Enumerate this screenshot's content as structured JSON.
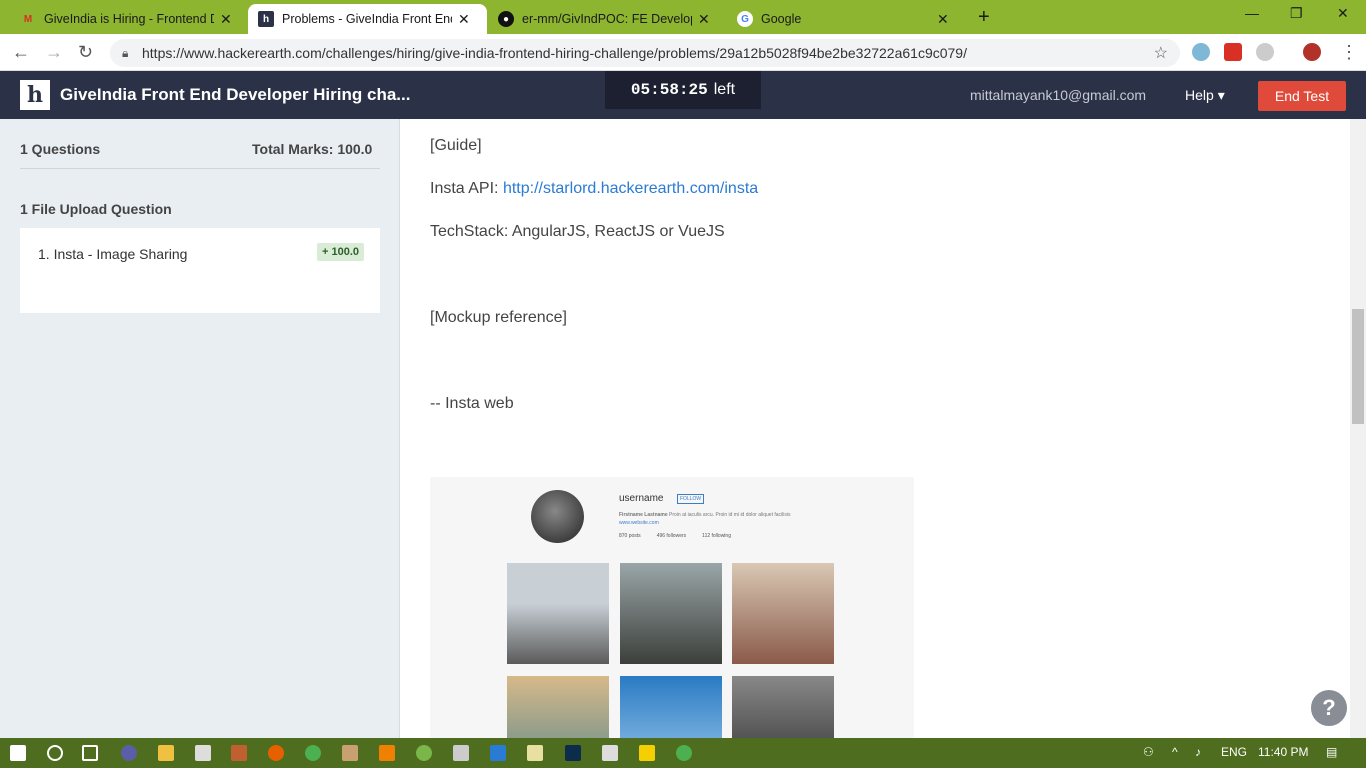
{
  "tabs": [
    {
      "title": "GiveIndia is Hiring - Frontend De",
      "icon": "gmail-icon"
    },
    {
      "title": "Problems - GiveIndia Front End D",
      "icon": "hackerearth-icon"
    },
    {
      "title": "er-mm/GivIndPOC: FE Developer",
      "icon": "github-icon"
    },
    {
      "title": "Google",
      "icon": "google-icon"
    }
  ],
  "url": "https://www.hackerearth.com/challenges/hiring/give-india-frontend-hiring-challenge/problems/29a12b5028f94be2be32722a61c9c079/",
  "header": {
    "title": "GiveIndia Front End Developer Hiring cha...",
    "timer": "05:58:25",
    "timer_suffix": "left",
    "email": "mittalmayank10@gmail.com",
    "help": "Help",
    "end_test": "End Test"
  },
  "sidebar": {
    "questions": "1 Questions",
    "total_marks": "Total Marks: 100.0",
    "section": "1 File Upload Question",
    "question_name": "1. Insta - Image Sharing",
    "question_badge": "+ 100.0"
  },
  "content": {
    "guide": "[Guide]",
    "api_label": "Insta API:",
    "api_link": "http://starlord.hackerearth.com/insta",
    "techstack": "TechStack: AngularJS, ReactJS or VueJS",
    "mockup": "[Mockup reference]",
    "insta_web": "-- Insta web"
  },
  "mockup": {
    "username": "username",
    "follow": "FOLLOW",
    "bio_name": "Firstname Lastname",
    "bio_text": "Proin at iaculis arcu. Proin id mi id dolor aliquet facilisis",
    "site": "www.website.com",
    "posts": "870 posts",
    "followers": "496 followers",
    "following": "112 following"
  },
  "taskbar": {
    "lang": "ENG",
    "time": "11:40 PM"
  }
}
